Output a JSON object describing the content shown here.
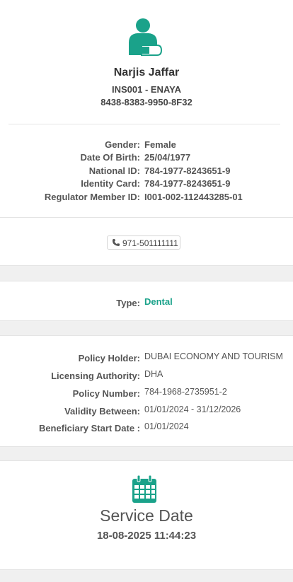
{
  "profile": {
    "name": "Narjis Jaffar",
    "code_line": "INS001 - ENAYA",
    "card_number": "8438-8383-9950-8F32",
    "fields": [
      {
        "label": "Gender:",
        "value": "Female"
      },
      {
        "label": "Date Of Birth:",
        "value": "25/04/1977"
      },
      {
        "label": "National ID:",
        "value": "784-1977-8243651-9"
      },
      {
        "label": "Identity Card:",
        "value": "784-1977-8243651-9"
      },
      {
        "label": "Regulator Member ID:",
        "value": "I001-002-112443285-01"
      }
    ],
    "avatar_icon": "patient-injured-arm-icon",
    "accent_color": "#1aa28a"
  },
  "contact": {
    "phone": "971-501111111",
    "phone_icon": "phone-icon"
  },
  "coverage": {
    "type_label": "Type:",
    "type_value": "Dental"
  },
  "policy": {
    "rows": [
      {
        "label": "Policy Holder:",
        "value": "DUBAI ECONOMY AND TOURISM"
      },
      {
        "label": "Licensing Authority:",
        "value": "DHA"
      },
      {
        "label": "Policy Number:",
        "value": "784-1968-2735951-2"
      },
      {
        "label": "Validity Between:",
        "value": "01/01/2024 - 31/12/2026"
      },
      {
        "label": "Beneficiary Start Date :",
        "value": "01/01/2024"
      }
    ]
  },
  "service": {
    "title": "Service Date",
    "datetime": "18-08-2025 11:44:23",
    "icon": "calendar-icon"
  }
}
